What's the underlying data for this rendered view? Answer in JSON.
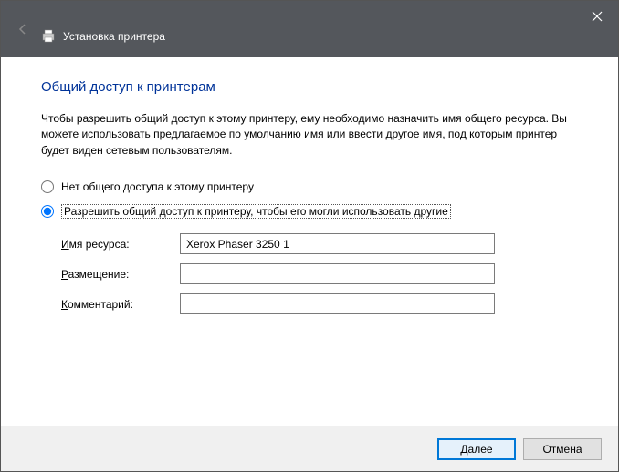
{
  "titlebar": {
    "title": "Установка принтера"
  },
  "content": {
    "heading": "Общий доступ к принтерам",
    "description": "Чтобы разрешить общий доступ к этому принтеру, ему необходимо назначить имя общего ресурса. Вы можете использовать предлагаемое по умолчанию имя или ввести другое имя, под которым принтер будет виден сетевым пользователям."
  },
  "radios": {
    "no_share": "Нет общего доступа к этому принтеру",
    "share": "Разрешить общий доступ к принтеру, чтобы его могли использовать другие"
  },
  "fields": {
    "share_name_label_prefix": "И",
    "share_name_label_rest": "мя ресурса:",
    "share_name_value": "Xerox Phaser 3250 1",
    "location_label_prefix": "Р",
    "location_label_rest": "азмещение:",
    "location_value": "",
    "comment_label_prefix": "К",
    "comment_label_rest": "омментарий:",
    "comment_value": ""
  },
  "footer": {
    "next_prefix": "Д",
    "next_rest": "алее",
    "cancel": "Отмена"
  }
}
